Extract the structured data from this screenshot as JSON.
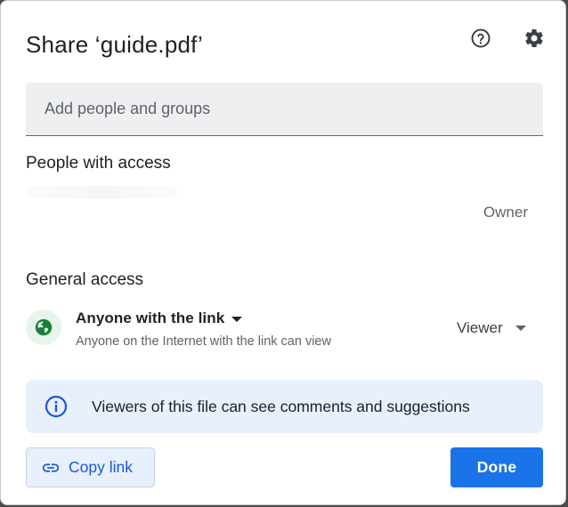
{
  "dialog": {
    "title": "Share ‘guide.pdf’",
    "help_icon": "help-circle-icon",
    "settings_icon": "gear-icon"
  },
  "add_people": {
    "placeholder": "Add people and groups",
    "value": ""
  },
  "people_with_access": {
    "heading": "People with access",
    "owner_role": "Owner"
  },
  "general_access": {
    "heading": "General access",
    "icon": "globe-icon",
    "access_level": "Anyone with the link",
    "description": "Anyone on the Internet with the link can view",
    "role": "Viewer"
  },
  "info_banner": {
    "icon": "info-icon",
    "text": "Viewers of this file can see comments and suggestions"
  },
  "actions": {
    "copy_link_icon": "link-icon",
    "copy_link_label": "Copy link",
    "done_label": "Done"
  },
  "colors": {
    "accent": "#1a73e8",
    "banner_bg": "#e8f0fe",
    "globe_green": "#188038"
  }
}
